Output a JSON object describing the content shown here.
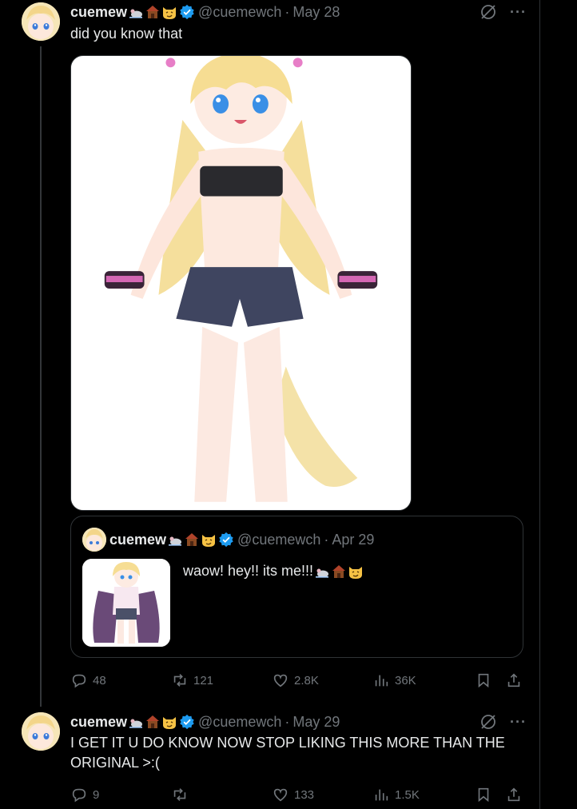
{
  "tweets": [
    {
      "display_name": "cuemew",
      "handle": "@cuemewch",
      "date": "May 28",
      "text": "did you know that",
      "icons": [
        "mouse-emoji",
        "house-emoji",
        "smirk-cat-emoji",
        "verified-badge-icon"
      ],
      "quote": {
        "display_name": "cuemew",
        "handle": "@cuemewch",
        "date": "Apr 29",
        "text": "waow! hey!! its me!!!"
      },
      "stats": {
        "replies": "48",
        "reposts": "121",
        "likes": "2.8K",
        "views": "36K"
      }
    },
    {
      "display_name": "cuemew",
      "handle": "@cuemewch",
      "date": "May 29",
      "text": "I GET IT U DO KNOW NOW STOP LIKING THIS MORE THAN THE ORIGINAL >:(",
      "stats": {
        "replies": "9",
        "reposts": "",
        "likes": "133",
        "views": "1.5K"
      }
    }
  ],
  "separators": {
    "dot": "·"
  },
  "colors": {
    "background": "#000000",
    "text": "#e7e9ea",
    "muted": "#71767b",
    "verified": "#1d9bf0",
    "border": "#2f3336"
  }
}
